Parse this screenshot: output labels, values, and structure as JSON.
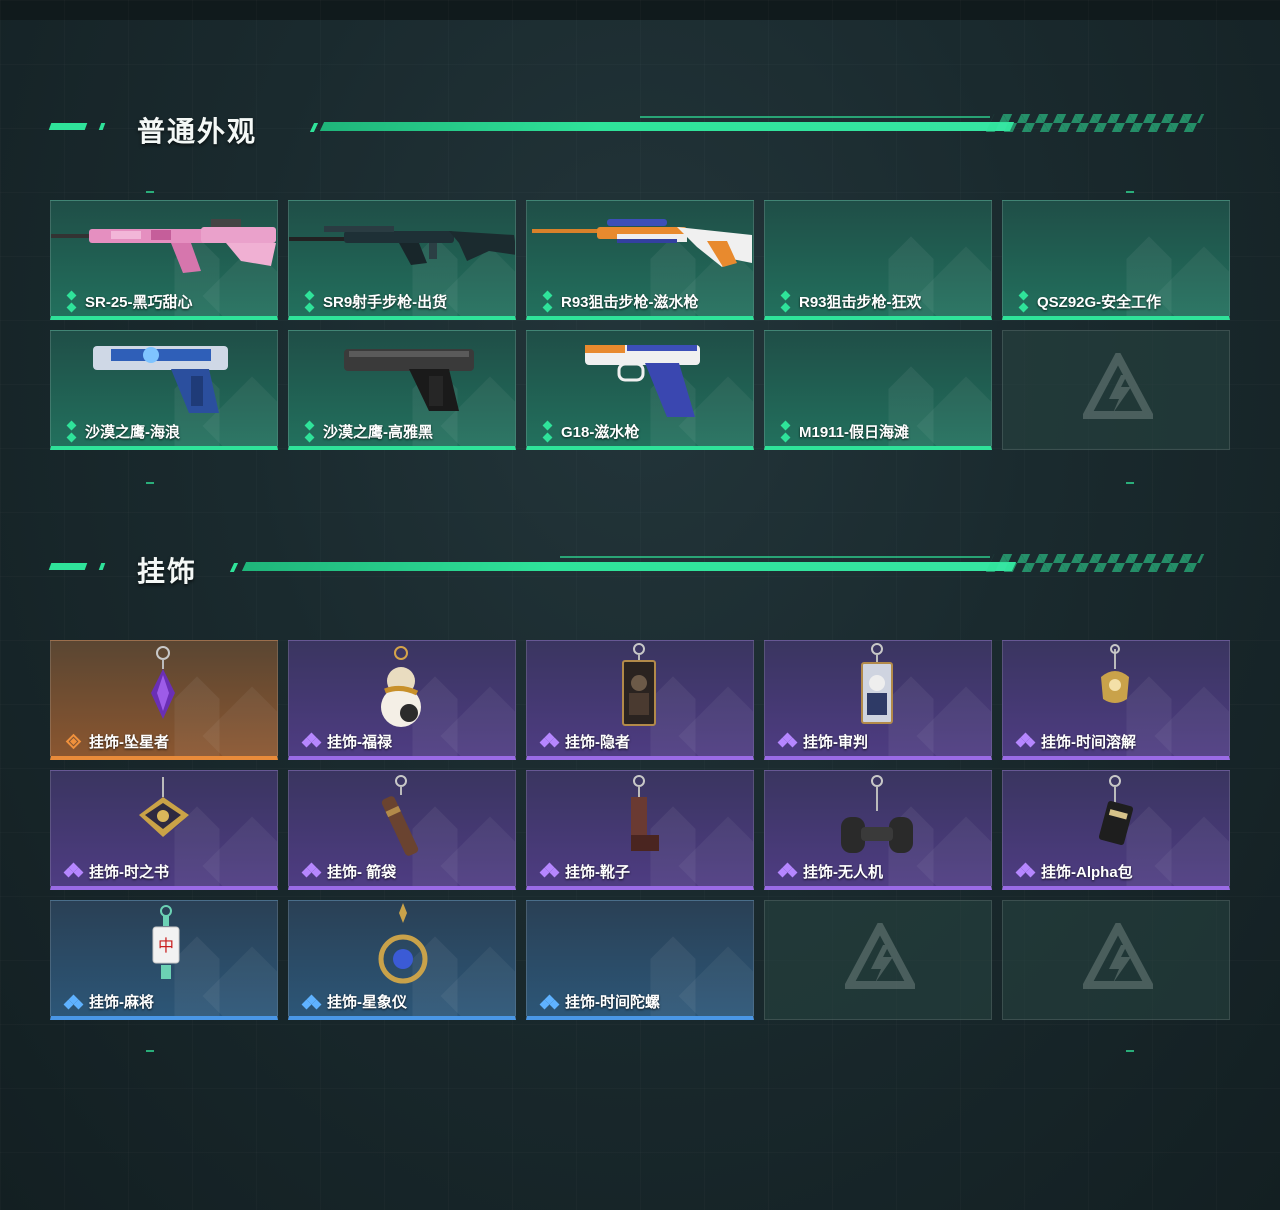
{
  "sections": {
    "skins": {
      "title": "普通外观",
      "items": [
        {
          "name": "SR-25-黑巧甜心",
          "rarity": "green",
          "icon": "pink-camo-rifle-icon"
        },
        {
          "name": "SR9射手步枪-出货",
          "rarity": "green",
          "icon": "dark-marksman-rifle-icon"
        },
        {
          "name": "R93狙击步枪-滋水枪",
          "rarity": "green",
          "icon": "water-gun-sniper-icon"
        },
        {
          "name": "R93狙击步枪-狂欢",
          "rarity": "green",
          "icon": ""
        },
        {
          "name": "QSZ92G-安全工作",
          "rarity": "green",
          "icon": ""
        },
        {
          "name": "沙漠之鹰-海浪",
          "rarity": "green",
          "icon": "wave-pistol-icon"
        },
        {
          "name": "沙漠之鹰-高雅黑",
          "rarity": "green",
          "icon": "black-pistol-icon"
        },
        {
          "name": "G18-滋水枪",
          "rarity": "green",
          "icon": "water-gun-pistol-icon"
        },
        {
          "name": "M1911-假日海滩",
          "rarity": "green",
          "icon": ""
        },
        {
          "name": "",
          "rarity": "empty",
          "icon": "game-logo-icon"
        }
      ]
    },
    "charms": {
      "title": "挂饰",
      "items": [
        {
          "name": "挂饰-坠星者",
          "rarity": "orange",
          "icon": "purple-crystal-charm-icon"
        },
        {
          "name": "挂饰-福禄",
          "rarity": "purple",
          "icon": "gourd-charm-icon"
        },
        {
          "name": "挂饰-隐者",
          "rarity": "purple",
          "icon": "hermit-card-charm-icon"
        },
        {
          "name": "挂饰-审判",
          "rarity": "purple",
          "icon": "judgement-card-charm-icon"
        },
        {
          "name": "挂饰-时间溶解",
          "rarity": "purple",
          "icon": "melting-clock-charm-icon"
        },
        {
          "name": "挂饰-时之书",
          "rarity": "purple",
          "icon": "book-charm-icon"
        },
        {
          "name": "挂饰- 箭袋",
          "rarity": "purple",
          "icon": "quiver-charm-icon"
        },
        {
          "name": "挂饰-靴子",
          "rarity": "purple",
          "icon": "boot-charm-icon"
        },
        {
          "name": "挂饰-无人机",
          "rarity": "purple",
          "icon": "drone-charm-icon"
        },
        {
          "name": "挂饰-Alpha包",
          "rarity": "purple",
          "icon": "alpha-bag-charm-icon"
        },
        {
          "name": "挂饰-麻将",
          "rarity": "blue",
          "icon": "mahjong-tile-charm-icon"
        },
        {
          "name": "挂饰-星象仪",
          "rarity": "blue",
          "icon": "astrolabe-charm-icon"
        },
        {
          "name": "挂饰-时间陀螺",
          "rarity": "blue",
          "icon": ""
        },
        {
          "name": "",
          "rarity": "empty",
          "icon": "game-logo-icon"
        },
        {
          "name": "",
          "rarity": "empty",
          "icon": "game-logo-icon"
        }
      ]
    }
  },
  "colors": {
    "accent": "#2fe39a",
    "green_rarity": "#2fe39a",
    "purple_rarity": "#9a6be6",
    "orange_rarity": "#e98b3a",
    "blue_rarity": "#4a97e6"
  }
}
